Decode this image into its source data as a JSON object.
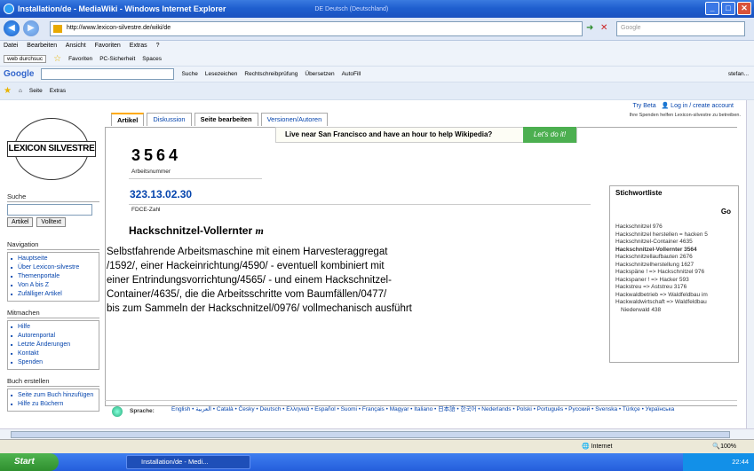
{
  "window": {
    "title": "Installation/de - MediaWiki - Windows Internet Explorer",
    "lang_indicator": "DE Deutsch (Deutschland)"
  },
  "address": {
    "url": "http://www.lexicon-silvestre.de/wiki/de",
    "search_placeholder": "Google"
  },
  "menu": [
    "Datei",
    "Bearbeiten",
    "Ansicht",
    "Favoriten",
    "Extras",
    "?"
  ],
  "toolbar1": {
    "search_text": "web durchsuc",
    "favoriten": "Favoriten",
    "pc_sicherheit": "PC-Sicherheit",
    "spaces": "Spaces"
  },
  "toolbar2": {
    "google": "Google",
    "suche": "Suche",
    "lesezeichen": "Lesezeichen",
    "rechtschreib": "Rechtschreibprüfung",
    "uebersetzen": "Übersetzen",
    "autofill": "AutoFill",
    "user": "stefan..."
  },
  "toolbar3": {
    "seite": "Seite",
    "extras": "Extras"
  },
  "top_links": {
    "try_beta": "Try Beta",
    "login": "Log in / create account",
    "donate": "Ihre Spenden helfen Lexicon-silvestre zu betreiben."
  },
  "tabs": [
    "Artikel",
    "Diskussion",
    "Seite bearbeiten",
    "Versionen/Autoren"
  ],
  "banner": {
    "text": "Live near San Francisco and have an hour to help Wikipedia?",
    "button": "Let's do it!"
  },
  "logo": {
    "text": "LEXICON SILVESTRE"
  },
  "article": {
    "number": "3564",
    "number_label": "Arbeitsnummer",
    "fdce": "323.13.02.30",
    "fdce_label": "FDCE-Zahl",
    "title": "Hackschnitzel-Vollernter",
    "gender": "m",
    "body": [
      "Selbstfahrende Arbeitsmaschine mit einem Harvesteraggregat",
      "/1592/, einer Hackeinrichtung/4590/ - eventuell kombiniert mit",
      "einer Entrindungsvorrichtung/4565/ - und einem Hackschnitzel-",
      "Container/4635/, die die Arbeitsschritte vom  Baumfällen/0477/",
      "bis zum Sammeln der Hackschnitzel/0976/ vollmechanisch ausführt"
    ]
  },
  "sidebar": {
    "search_title": "Suche",
    "btn_artikel": "Artikel",
    "btn_volltext": "Volltext",
    "nav_title": "Navigation",
    "nav": [
      "Hauptseite",
      "Über Lexicon-silvestre",
      "Themenportale",
      "Von A bis Z",
      "Zufälliger Artikel"
    ],
    "mit_title": "Mitmachen",
    "mit": [
      "Hilfe",
      "Autorenportal",
      "Letzte Änderungen",
      "Kontakt",
      "Spenden"
    ],
    "buch_title": "Buch erstellen",
    "buch": [
      "Seite zum Buch hinzufügen",
      "Hilfe zu Büchern"
    ]
  },
  "stichwort": {
    "title": "Stichwortliste",
    "go": "Go",
    "items": [
      "Hackschnitzel 976",
      "Hackschnitzel herstellen = hacken 5",
      "Hackschnitzel-Container 4635",
      "Hackschnitzel-Vollernter 3564",
      "Hackschnitzellaufbauten 2676",
      "Hackschnitzelherstellung 1627",
      "Hackspäne ! => Hackschnitzel 976",
      "Hackspaner ! => Hacker 593",
      "Hackstreu => Aststreu 3176",
      "Hackwaldbetrieb => Waldfeldbau im",
      "Hackwaldwirtschaft => Waldfeldbau",
      "  Niederwald 438"
    ]
  },
  "languages": {
    "label": "Sprache:",
    "list": "English • العربية • Català • Česky • Deutsch • Ελληνικά • Español • Suomi • Français • Magyar • Italiano • 日本語 • 한국어 • Nederlands • Polski • Português • Русский • Svenska • Türkçe • Українська"
  },
  "status": {
    "zone": "Internet",
    "zoom": "100%"
  },
  "taskbar": {
    "start": "Start",
    "task": "Installation/de - Medi...",
    "clock": "22:44"
  }
}
